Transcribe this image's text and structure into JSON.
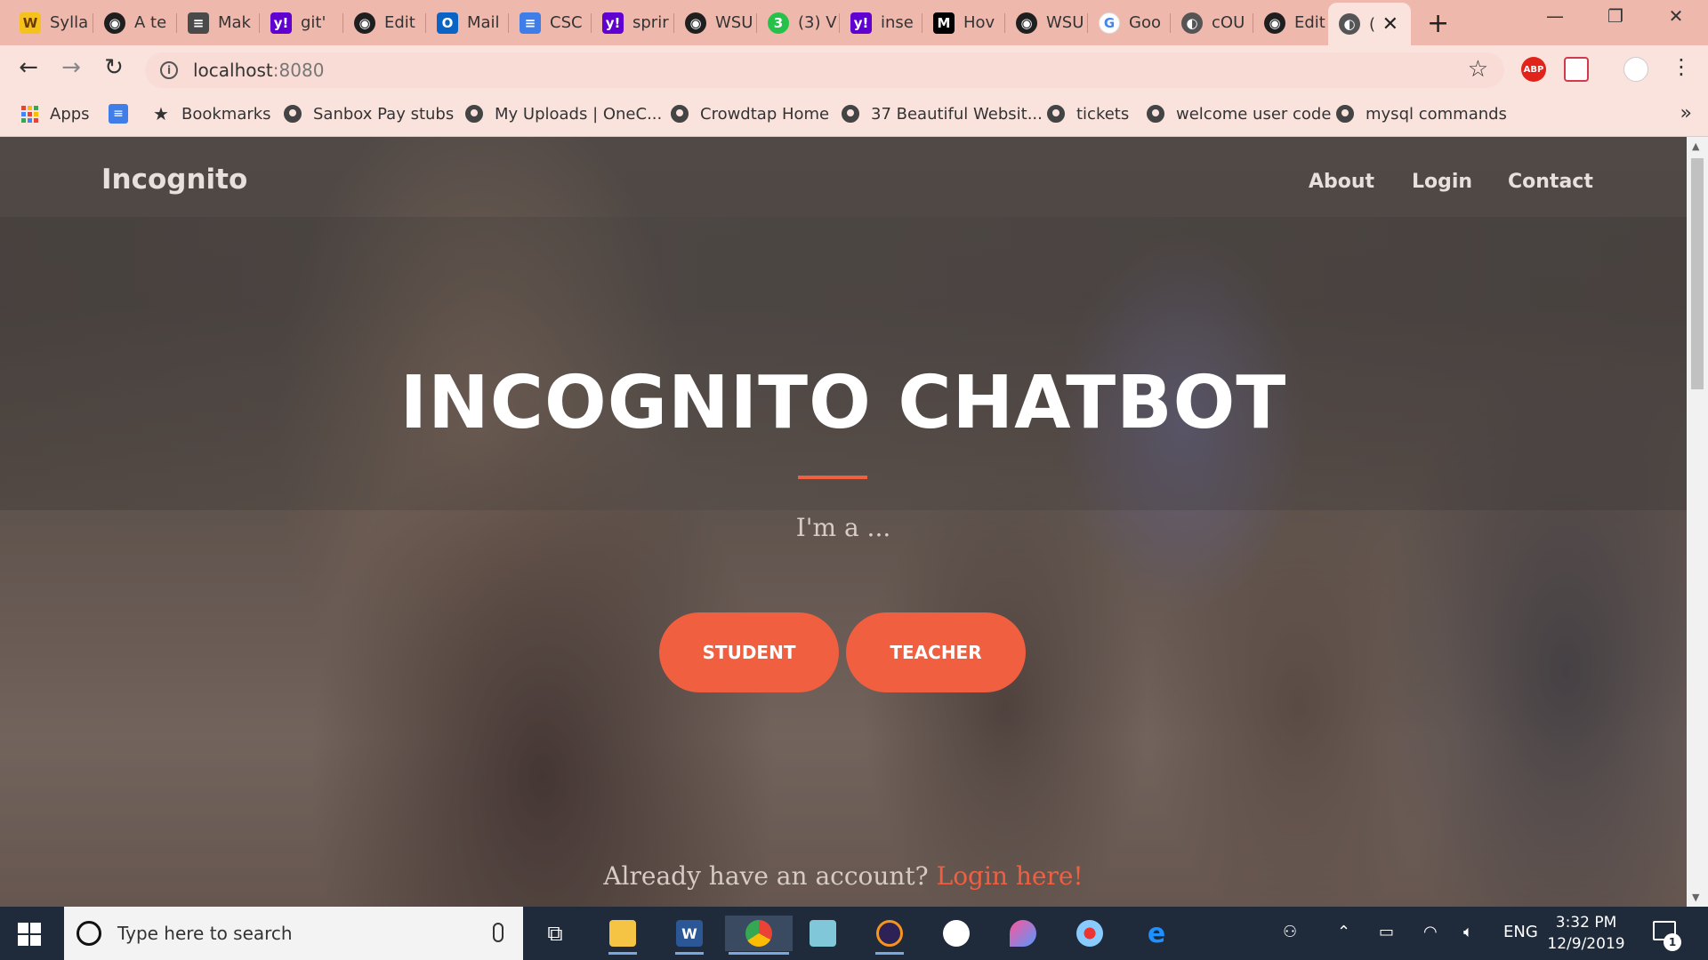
{
  "browser": {
    "tabs": [
      {
        "title": "Sylla",
        "icon": "w-icon"
      },
      {
        "title": "A te",
        "icon": "github-icon"
      },
      {
        "title": "Mak",
        "icon": "doc-icon"
      },
      {
        "title": "git'",
        "icon": "yahoo-icon"
      },
      {
        "title": "Edit",
        "icon": "github-icon"
      },
      {
        "title": "Mail",
        "icon": "outlook-icon"
      },
      {
        "title": "CSC",
        "icon": "google-docs-icon"
      },
      {
        "title": "sprir",
        "icon": "yahoo-icon"
      },
      {
        "title": "WSU",
        "icon": "github-icon"
      },
      {
        "title": "(3) V",
        "icon": "whatsapp-icon"
      },
      {
        "title": "inse",
        "icon": "yahoo-icon"
      },
      {
        "title": "Hov",
        "icon": "medium-icon"
      },
      {
        "title": "WSU",
        "icon": "github-icon"
      },
      {
        "title": "Goo",
        "icon": "google-icon"
      },
      {
        "title": "cOU",
        "icon": "globe-icon"
      },
      {
        "title": "Edit",
        "icon": "github-icon"
      },
      {
        "title": "(",
        "icon": "globe-icon"
      }
    ],
    "address": {
      "host": "localhost",
      "port": ":8080"
    },
    "bookmarks": [
      {
        "label": "Apps"
      },
      {
        "label": ""
      },
      {
        "label": "Bookmarks"
      },
      {
        "label": "Sanbox Pay stubs"
      },
      {
        "label": "My Uploads | OneC..."
      },
      {
        "label": "Crowdtap Home"
      },
      {
        "label": "37 Beautiful Websit..."
      },
      {
        "label": "tickets"
      },
      {
        "label": "welcome user code"
      },
      {
        "label": "mysql commands"
      }
    ],
    "more_bookmarks": "»"
  },
  "site": {
    "brand": "Incognito",
    "nav": {
      "about": "About",
      "login": "Login",
      "contact": "Contact"
    },
    "hero": {
      "title": "INCOGNITO CHATBOT",
      "subtitle": "I'm a ...",
      "student_button": "STUDENT",
      "teacher_button": "TEACHER",
      "account_prompt": "Already have an account?",
      "account_link": "Login here!"
    }
  },
  "taskbar": {
    "search_placeholder": "Type here to search",
    "language": "ENG",
    "time": "3:32 PM",
    "date": "12/9/2019",
    "notification_count": "1"
  },
  "colors": {
    "accent": "#f05f40",
    "browser_frame": "#efb8ad",
    "taskbar": "#1f2a3a"
  }
}
